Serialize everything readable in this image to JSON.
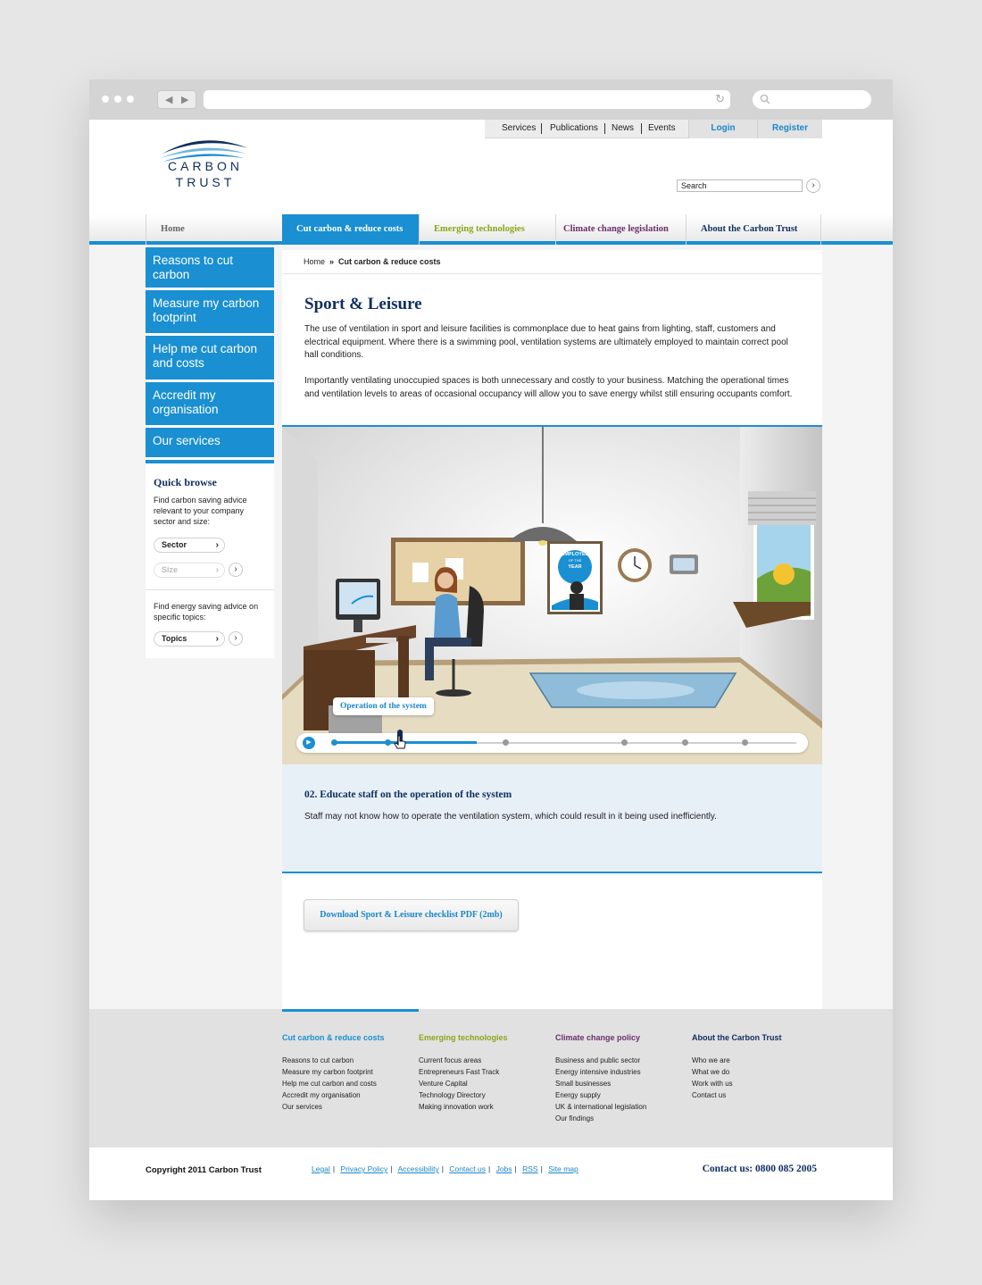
{
  "browser": {
    "search_placeholder": ""
  },
  "header": {
    "logo": {
      "line1": "CARBON",
      "line2": "TRUST"
    },
    "top_links": [
      "Services",
      "Publications",
      "News",
      "Events"
    ],
    "login": "Login",
    "register": "Register",
    "search_value": "Search"
  },
  "main_nav": {
    "items": [
      {
        "label": "Home",
        "color": "#666666"
      },
      {
        "label": "Cut carbon & reduce costs",
        "color": "#ffffff",
        "active": true
      },
      {
        "label": "Emerging technologies",
        "color": "#8aa61a"
      },
      {
        "label": "Climate change legislation",
        "color": "#6b2f6b"
      },
      {
        "label": "About the Carbon Trust",
        "color": "#0f2d5f"
      }
    ]
  },
  "sidebar": {
    "items": [
      "Reasons to cut carbon",
      "Measure my carbon footprint",
      "Help me cut carbon and costs",
      "Accredit my organisation",
      "Our services"
    ],
    "quick_browse": {
      "title": "Quick browse",
      "text1": "Find carbon saving advice relevant to your company sector and size:",
      "sector": "Sector",
      "size": "Size",
      "text2": "Find energy saving advice on specific topics:",
      "topics": "Topics"
    }
  },
  "breadcrumb": {
    "home": "Home",
    "sep": "»",
    "current": "Cut carbon & reduce costs"
  },
  "content": {
    "title": "Sport & Leisure",
    "paragraphs": [
      "The use of ventilation in sport and leisure facilities is commonplace due to heat gains from lighting, staff, customers and electrical equipment. Where there is a swimming pool, ventilation systems are ultimately employed to maintain correct pool hall conditions.",
      "Importantly ventilating unoccupied spaces is both unnecessary and costly to your business. Matching the operational times and ventilation levels to areas of occasional occupancy will allow you to save energy whilst still ensuring occupants comfort."
    ],
    "illustration": {
      "poster_line1": "EMPLOYEE",
      "poster_line2": "OF THE",
      "poster_line3": "YEAR",
      "tooltip": "Operation of the system",
      "progress": 0.28
    },
    "step": {
      "title": "02. Educate staff on the operation of the system",
      "text": "Staff may not know how to operate the ventilation system, which could result in it being used inefficiently."
    },
    "download": "Download Sport & Leisure checklist PDF (2mb)"
  },
  "footer": {
    "columns": [
      {
        "title": "Cut carbon & reduce costs",
        "color": "#1a8fd1",
        "links": [
          "Reasons to cut carbon",
          "Measure my carbon footprint",
          "Help me cut carbon and costs",
          "Accredit my organisation",
          "Our services"
        ]
      },
      {
        "title": "Emerging technologies",
        "color": "#8aa61a",
        "links": [
          "Current focus areas",
          "Entrepreneurs Fast Track",
          "Venture Capital",
          "Technology Directory",
          "Making innovation work"
        ]
      },
      {
        "title": "Climate change policy",
        "color": "#6b2f6b",
        "links": [
          "Business and public sector",
          "Energy intensive industries",
          "Small businesses",
          "Energy supply",
          "UK & international legislation",
          "Our findings"
        ]
      },
      {
        "title": "About the Carbon Trust",
        "color": "#0f2d5f",
        "links": [
          "Who we are",
          "What we do",
          "Work with us",
          "Contact us"
        ]
      }
    ],
    "copyright": "Copyright 2011 Carbon Trust",
    "legal_links": [
      "Legal",
      "Privacy Policy",
      "Accessibility",
      "Contact us",
      "Jobs",
      "RSS",
      "Site map"
    ],
    "contact": "Contact us: 0800 085 2005"
  }
}
